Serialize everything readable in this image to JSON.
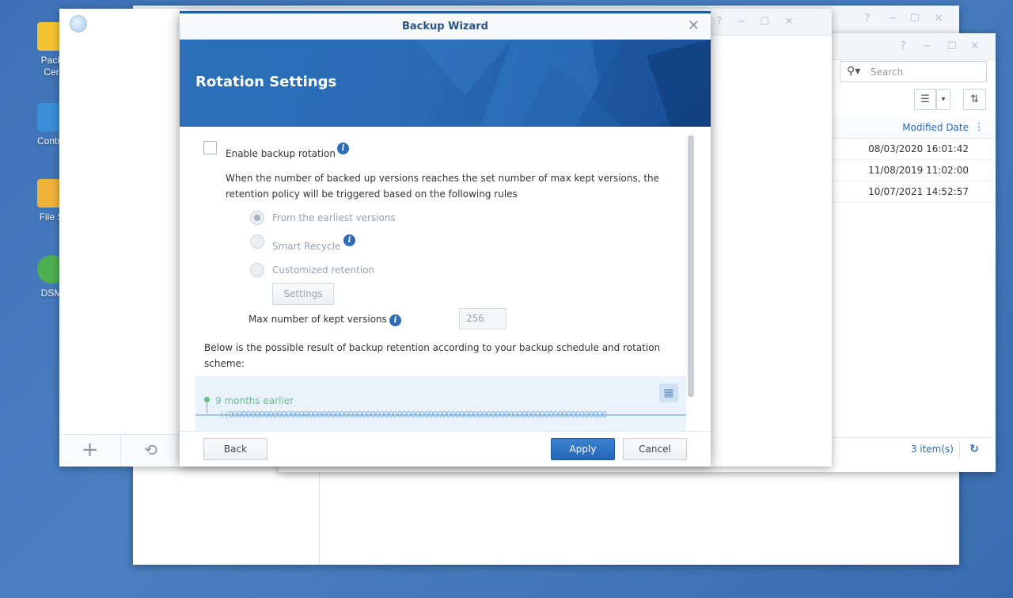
{
  "desktop": {
    "icons": [
      {
        "label": "Pack",
        "label2": "Cer",
        "color": "#f3c432"
      },
      {
        "label": "Contro",
        "color": "#3a8fd8"
      },
      {
        "label": "File S",
        "color": "#f0b43b"
      },
      {
        "label": "DSM",
        "color": "#4caf50"
      }
    ]
  },
  "file_station": {
    "search_placeholder": "Search",
    "column_header": "Modified Date",
    "rows": [
      {
        "modified": "08/03/2020 16:01:42"
      },
      {
        "modified": "11/08/2019 11:02:00"
      },
      {
        "modified": "10/07/2021 14:52:57"
      }
    ],
    "item_count": "3 item(s)"
  },
  "wizard": {
    "title": "Backup Wizard",
    "banner_title": "Rotation Settings",
    "enable_rotation_label": "Enable backup rotation",
    "description_line1": "When the number of backed up versions reaches the set number of max kept versions, the",
    "description_line2": "retention policy will be triggered based on the following rules",
    "options": [
      {
        "label": "From the earliest versions",
        "selected": true
      },
      {
        "label": "Smart Recycle",
        "selected": false
      },
      {
        "label": "Customized retention",
        "selected": false
      }
    ],
    "settings_button": "Settings",
    "max_versions_label": "Max number of kept versions",
    "max_versions_value": "256",
    "result_line1": "Below is the possible result of backup retention according to your backup schedule and rotation",
    "result_line2": "scheme:",
    "timeline_label": "9 months earlier",
    "back_button": "Back",
    "apply_button": "Apply",
    "cancel_button": "Cancel"
  },
  "glyphs": {
    "help": "?",
    "minimize": "−",
    "maximize": "☐",
    "close": "✕",
    "search": "⚲▾",
    "list_view": "☰",
    "dropdown": "▾",
    "sort": "⇅",
    "menu_more": "⋮",
    "refresh": "↻",
    "add": "+",
    "history": "⟲",
    "info": "i",
    "calendar": "▦",
    "timeline_circles": "((OOOOOOOOOOOOOOOOOOOOOOOOOOOOOOOOOOOOOOOOOOOOOOOOOOOOOOOOOOOOOOOOOOOOOOOOOOOOOOOOOOOOO"
  }
}
